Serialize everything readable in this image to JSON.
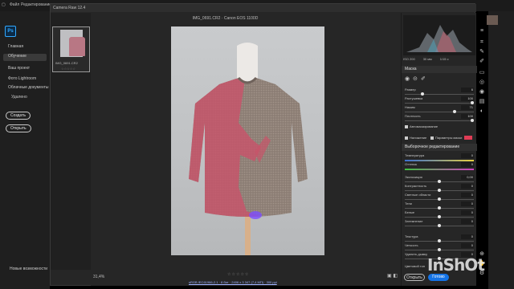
{
  "ps": {
    "menu": [
      "Файл",
      "Редактирование"
    ],
    "logo": "Ps",
    "sidebar": {
      "home": "Главная",
      "learn": "Обучение",
      "your_work": "Ваш проект",
      "lightroom": "Фото Lightroom",
      "cloud_docs": "Облачные документы",
      "deleted": "Удалено",
      "create": "Создать",
      "open": "Открыть",
      "whats_new": "Новые возможности"
    }
  },
  "camera_raw": {
    "title": "Camera Raw 12.4",
    "file_header": "IMG_0691.CR2  ·  Canon EOS 1100D",
    "filmstrip": {
      "name": "IMG_0691.CR2",
      "stars": "☆☆☆☆☆"
    },
    "zoom": "31,4%",
    "stars": "☆☆☆☆☆",
    "file_info": "sRGB IEC61966-2.1 · 8 бит · 2406 x 3 347 (7,4 МП) · 300 ppi",
    "histogram_info": {
      "iso": "ISO 200",
      "focal": "30 мм",
      "aperture": "f/3.5",
      "shutter": "1/15 c"
    },
    "masking": {
      "title": "Маска",
      "size_label": "Размер",
      "size_value": "6",
      "feather_label": "Растушевка",
      "feather_value": "100",
      "flow_label": "Нажим",
      "flow_value": "71",
      "density_label": "Плотность",
      "density_value": "100",
      "auto_mask": "Автомаскирование",
      "overlay": "Наложение",
      "mask_params": "Параметры маски",
      "overlay_color": "#e03c55"
    },
    "local": {
      "title": "Выборочное редактирование",
      "rows": [
        {
          "label": "Температура",
          "value": "0"
        },
        {
          "label": "Оттенок",
          "value": "0"
        },
        {
          "label": "Экспозиция",
          "value": "0,00"
        },
        {
          "label": "Контрастность",
          "value": "0"
        },
        {
          "label": "Светлые области",
          "value": "0"
        },
        {
          "label": "Тени",
          "value": "0"
        },
        {
          "label": "Белые",
          "value": "0"
        },
        {
          "label": "Затемнение",
          "value": "0"
        },
        {
          "label": "Текстура",
          "value": "0"
        },
        {
          "label": "Четкость",
          "value": "0"
        },
        {
          "label": "Удалить дымку",
          "value": "0"
        },
        {
          "label": "Цветовой тон",
          "value": ""
        }
      ]
    },
    "footer": {
      "open": "Открыть",
      "done": "Готово"
    }
  },
  "watermark": "InShOt"
}
